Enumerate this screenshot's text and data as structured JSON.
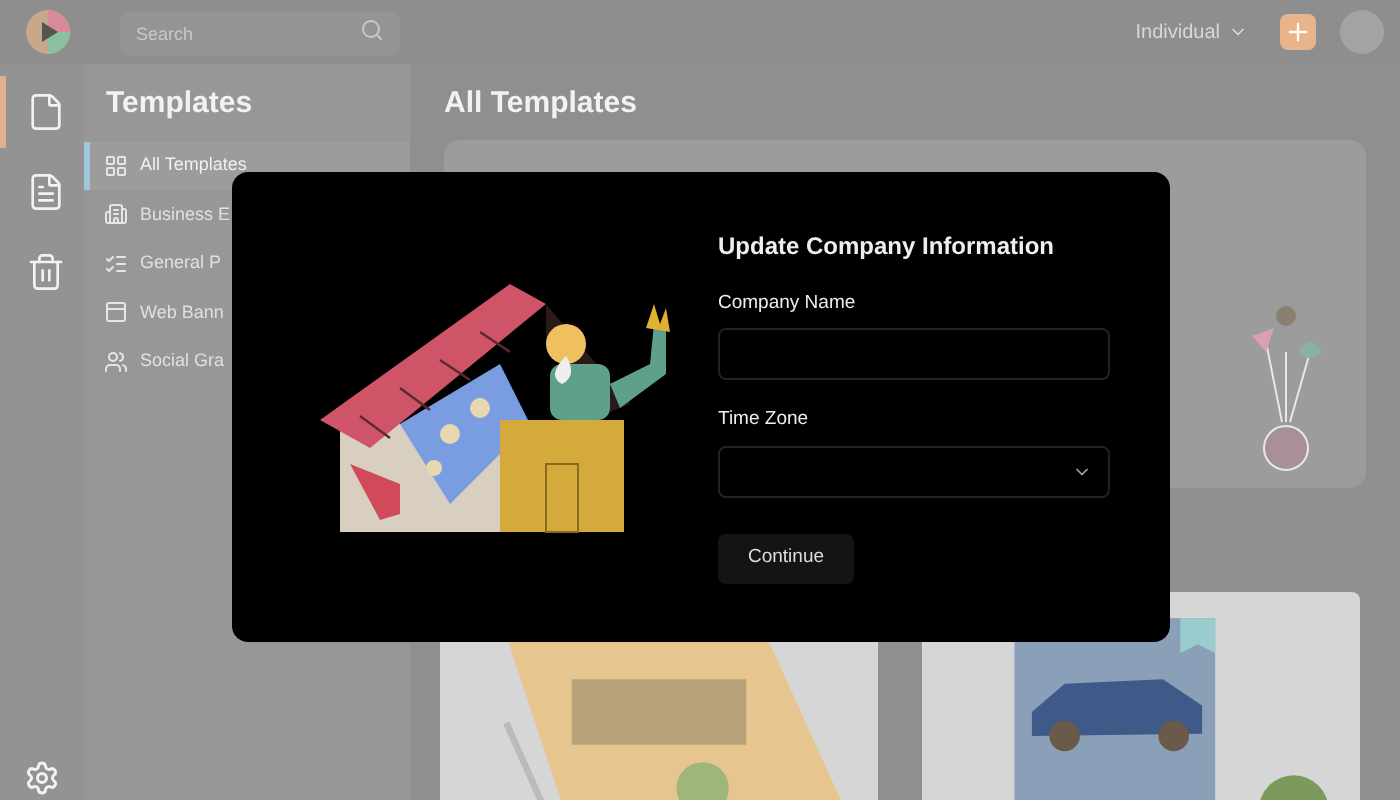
{
  "topbar": {
    "search": {
      "placeholder": "Search"
    },
    "account": "Individual"
  },
  "rail": [
    {
      "kind": "file",
      "selected": true
    },
    {
      "kind": "document",
      "selected": false
    },
    {
      "kind": "trash",
      "selected": false
    }
  ],
  "sidebar": {
    "title": "Templates",
    "items": [
      {
        "label": "All Templates",
        "kind": "grid",
        "selected": true
      },
      {
        "label": "Business E",
        "kind": "building",
        "selected": false
      },
      {
        "label": "General P",
        "kind": "list",
        "selected": false
      },
      {
        "label": "Web Bann",
        "kind": "banner",
        "selected": false
      },
      {
        "label": "Social Gra",
        "kind": "social",
        "selected": false
      }
    ]
  },
  "main": {
    "title": "All Templates"
  },
  "modal": {
    "title": "Update Company Information",
    "fields": [
      {
        "label": "Company Name",
        "kind": "text"
      },
      {
        "label": "Time Zone",
        "kind": "select"
      }
    ],
    "button": "Continue"
  }
}
